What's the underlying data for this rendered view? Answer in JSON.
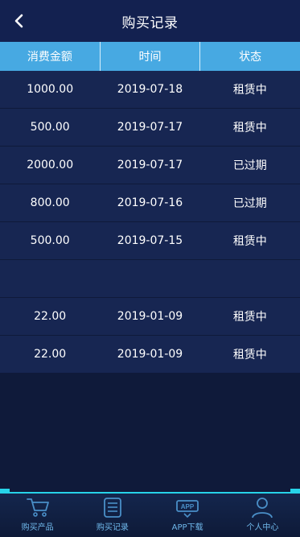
{
  "header": {
    "title": "购买记录"
  },
  "table": {
    "columns": [
      "消费金额",
      "时间",
      "状态"
    ],
    "rows": [
      [
        "1000.00",
        "2019-07-18",
        "租赁中"
      ],
      [
        "500.00",
        "2019-07-17",
        "租赁中"
      ],
      [
        "2000.00",
        "2019-07-17",
        "已过期"
      ],
      [
        "800.00",
        "2019-07-16",
        "已过期"
      ],
      [
        "500.00",
        "2019-07-15",
        "租赁中"
      ],
      [
        "",
        "",
        ""
      ],
      [
        "22.00",
        "2019-01-09",
        "租赁中"
      ],
      [
        "22.00",
        "2019-01-09",
        "租赁中"
      ]
    ]
  },
  "nav": {
    "items": [
      {
        "label": "购买产品",
        "icon": "cart-icon"
      },
      {
        "label": "购买记录",
        "icon": "records-icon"
      },
      {
        "label": "APP下载",
        "icon": "app-download-icon"
      },
      {
        "label": "个人中心",
        "icon": "user-icon"
      }
    ]
  },
  "colors": {
    "background": "#0f1a3a",
    "header": "#132150",
    "table_header": "#47a9e2",
    "row": "#172652",
    "nav_accent": "#27d3e9",
    "nav_label": "#6fb7ea"
  }
}
